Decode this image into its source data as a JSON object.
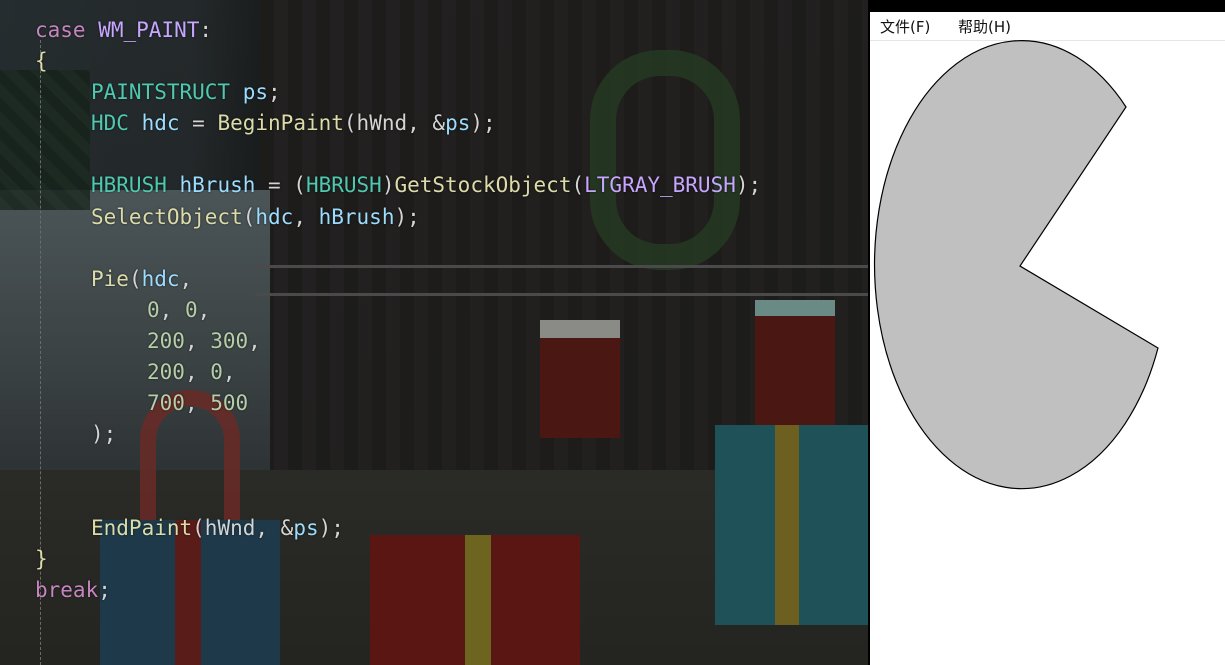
{
  "editor": {
    "lines": [
      {
        "indent": 0,
        "tokens": [
          {
            "t": "case",
            "c": "kw"
          },
          {
            "t": " ",
            "c": "punc"
          },
          {
            "t": "WM_PAINT",
            "c": "const"
          },
          {
            "t": ":",
            "c": "punc"
          }
        ]
      },
      {
        "indent": 0,
        "tokens": [
          {
            "t": "{",
            "c": "fn"
          }
        ]
      },
      {
        "indent": 1,
        "tokens": [
          {
            "t": "PAINTSTRUCT",
            "c": "type"
          },
          {
            "t": " ",
            "c": "punc"
          },
          {
            "t": "ps",
            "c": "var"
          },
          {
            "t": ";",
            "c": "punc"
          }
        ]
      },
      {
        "indent": 1,
        "tokens": [
          {
            "t": "HDC",
            "c": "type"
          },
          {
            "t": " ",
            "c": "punc"
          },
          {
            "t": "hdc",
            "c": "var"
          },
          {
            "t": " = ",
            "c": "punc"
          },
          {
            "t": "BeginPaint",
            "c": "fn"
          },
          {
            "t": "(hWnd, &",
            "c": "punc"
          },
          {
            "t": "ps",
            "c": "var"
          },
          {
            "t": ");",
            "c": "punc"
          }
        ]
      },
      {
        "indent": 0,
        "tokens": []
      },
      {
        "indent": 1,
        "tokens": [
          {
            "t": "HBRUSH",
            "c": "type"
          },
          {
            "t": " ",
            "c": "punc"
          },
          {
            "t": "hBrush",
            "c": "var"
          },
          {
            "t": " = (",
            "c": "punc"
          },
          {
            "t": "HBRUSH",
            "c": "type"
          },
          {
            "t": ")",
            "c": "punc"
          },
          {
            "t": "GetStockObject",
            "c": "fn"
          },
          {
            "t": "(",
            "c": "punc"
          },
          {
            "t": "LTGRAY_BRUSH",
            "c": "const"
          },
          {
            "t": ");",
            "c": "punc"
          }
        ]
      },
      {
        "indent": 1,
        "tokens": [
          {
            "t": "SelectObject",
            "c": "fn"
          },
          {
            "t": "(",
            "c": "punc"
          },
          {
            "t": "hdc",
            "c": "var"
          },
          {
            "t": ", ",
            "c": "punc"
          },
          {
            "t": "hBrush",
            "c": "var"
          },
          {
            "t": ");",
            "c": "punc"
          }
        ]
      },
      {
        "indent": 0,
        "tokens": []
      },
      {
        "indent": 1,
        "tokens": [
          {
            "t": "Pie",
            "c": "fn"
          },
          {
            "t": "(",
            "c": "punc"
          },
          {
            "t": "hdc",
            "c": "var"
          },
          {
            "t": ",",
            "c": "punc"
          }
        ]
      },
      {
        "indent": 2,
        "tokens": [
          {
            "t": "0",
            "c": "num"
          },
          {
            "t": ", ",
            "c": "punc"
          },
          {
            "t": "0",
            "c": "num"
          },
          {
            "t": ",",
            "c": "punc"
          }
        ]
      },
      {
        "indent": 2,
        "tokens": [
          {
            "t": "200",
            "c": "num"
          },
          {
            "t": ", ",
            "c": "punc"
          },
          {
            "t": "300",
            "c": "num"
          },
          {
            "t": ",",
            "c": "punc"
          }
        ]
      },
      {
        "indent": 2,
        "tokens": [
          {
            "t": "200",
            "c": "num"
          },
          {
            "t": ", ",
            "c": "punc"
          },
          {
            "t": "0",
            "c": "num"
          },
          {
            "t": ",",
            "c": "punc"
          }
        ]
      },
      {
        "indent": 2,
        "tokens": [
          {
            "t": "700",
            "c": "num"
          },
          {
            "t": ", ",
            "c": "punc"
          },
          {
            "t": "500",
            "c": "num"
          }
        ]
      },
      {
        "indent": 1,
        "tokens": [
          {
            "t": ");",
            "c": "punc"
          }
        ]
      },
      {
        "indent": 0,
        "tokens": []
      },
      {
        "indent": 0,
        "tokens": []
      },
      {
        "indent": 1,
        "tokens": [
          {
            "t": "EndPaint",
            "c": "fn"
          },
          {
            "t": "(hWnd, &",
            "c": "punc"
          },
          {
            "t": "ps",
            "c": "var"
          },
          {
            "t": ");",
            "c": "punc"
          }
        ]
      },
      {
        "indent": 0,
        "tokens": [
          {
            "t": "}",
            "c": "fn"
          }
        ]
      },
      {
        "indent": 0,
        "tokens": [
          {
            "t": "break",
            "c": "kw"
          },
          {
            "t": ";",
            "c": "punc"
          }
        ]
      }
    ]
  },
  "window": {
    "menu": {
      "file_label": "文件(F)",
      "help_label": "帮助(H)"
    },
    "pie": {
      "fill": "#c0c0c0",
      "stroke": "#000000"
    }
  }
}
